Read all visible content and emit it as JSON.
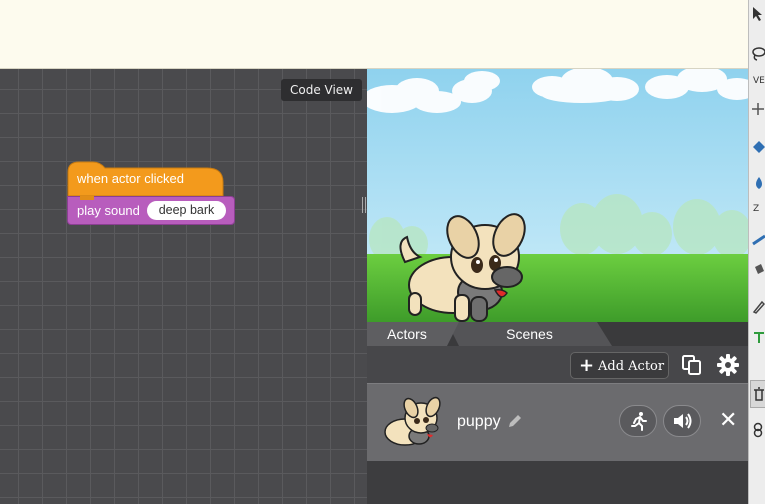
{
  "code_area": {
    "code_view_label": "Code View",
    "blocks": {
      "hat_label": "when actor clicked",
      "stack_label": "play sound",
      "sound_value": "deep bark"
    }
  },
  "panel_tabs": {
    "actors": "Actors",
    "scenes": "Scenes"
  },
  "actors_toolbar": {
    "add_actor_label": "Add Actor"
  },
  "actor_list": [
    {
      "name": "puppy"
    }
  ],
  "right_strip": {
    "letters": [
      "VE",
      "Z"
    ]
  },
  "colors": {
    "event_block": "#f39a1c",
    "sound_block": "#b85dbd",
    "sky": "#a9def2",
    "grass": "#5bc23a"
  }
}
